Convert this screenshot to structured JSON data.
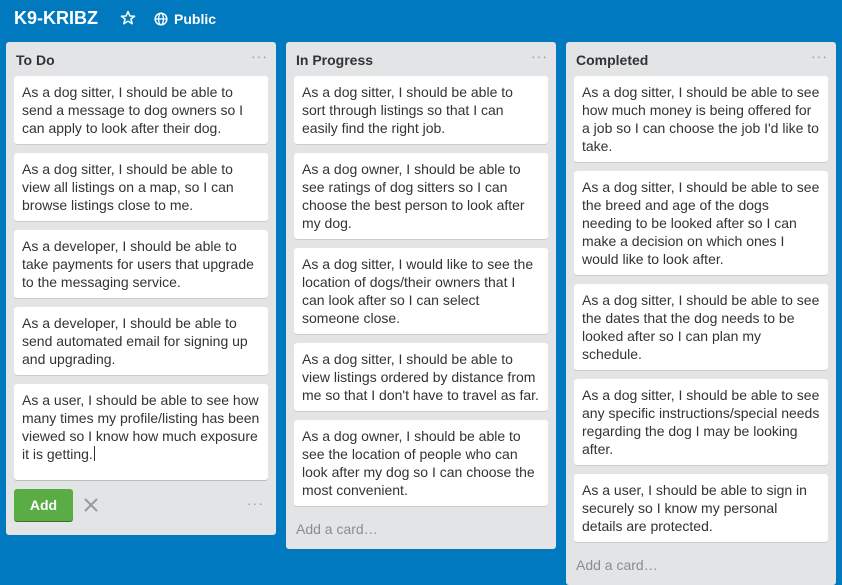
{
  "header": {
    "board_title": "K9-KRIBZ",
    "visibility_label": "Public",
    "star_icon": "star-icon",
    "globe_icon": "globe-icon"
  },
  "lists": [
    {
      "title": "To Do",
      "menu": "···",
      "cards": [
        "As a dog sitter, I should be able to send a message to dog owners so I can apply to look after their dog.",
        "As a dog sitter, I should be able to view all listings on a map, so I can browse listings close to me.",
        "As a developer, I should be able to take payments for users that upgrade to the messaging service.",
        "As a developer, I should be able to send automated email for signing up and upgrading."
      ],
      "composer": {
        "text": "As a user, I should be able to see how many times my profile/listing has been viewed so I know how much exposure it is getting.",
        "add_label": "Add",
        "close_icon": "close-icon",
        "more": "···"
      }
    },
    {
      "title": "In Progress",
      "menu": "···",
      "cards": [
        "As a dog sitter, I should be able to sort through listings so that I can easily find the right job.",
        "As a dog owner, I should be able to see ratings of dog sitters so I can choose the best person to look after my dog.",
        "As a dog sitter, I would like to see the location of dogs/their owners that I can look after so I can select someone close.",
        "As a dog sitter, I should be able to view listings ordered by distance from me so that I don't have to travel as far.",
        "As a dog owner, I should be able to see the location of people who can look after my dog so I can choose the most convenient."
      ],
      "add_card": "Add a card…"
    },
    {
      "title": "Completed",
      "menu": "···",
      "cards": [
        "As a dog sitter, I should be able to see how much money is being offered for a job so I can choose the job I'd like to take.",
        "As a dog sitter, I should be able to see the breed and age of the dogs needing to be looked after so I can make a decision on which ones I would like to look after.",
        "As a dog sitter, I should be able to see the dates that the dog needs to be looked after so I can plan my schedule.",
        "As a dog sitter, I should be able to see any specific instructions/special needs regarding the dog I may be looking after.",
        "As a user, I should be able to sign in securely so I know my personal details are protected."
      ],
      "add_card": "Add a card…"
    }
  ],
  "colors": {
    "board_background": "#0079bf",
    "list_background": "#e2e4e6",
    "add_button": "#5aac44"
  }
}
